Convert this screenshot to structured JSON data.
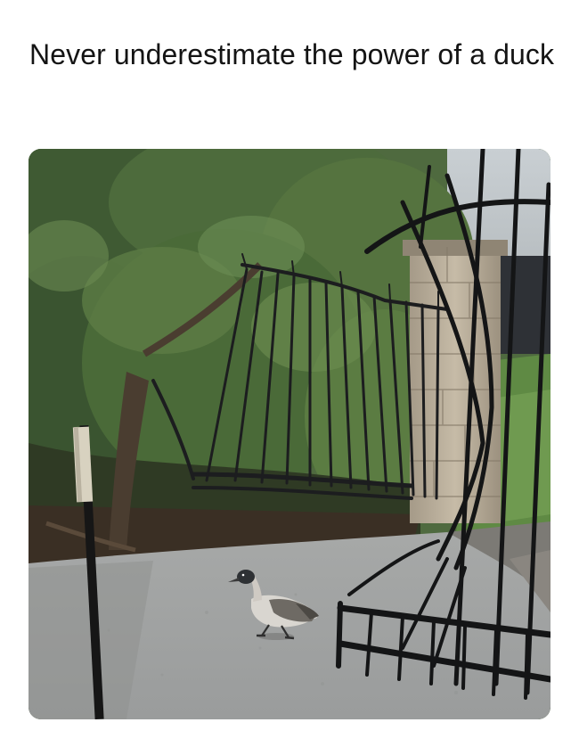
{
  "post": {
    "caption": "Never underestimate the power of a duck"
  },
  "photo": {
    "subject": "duck",
    "alt": "A duck walking past a bent, broken iron gate on a paved driveway"
  }
}
